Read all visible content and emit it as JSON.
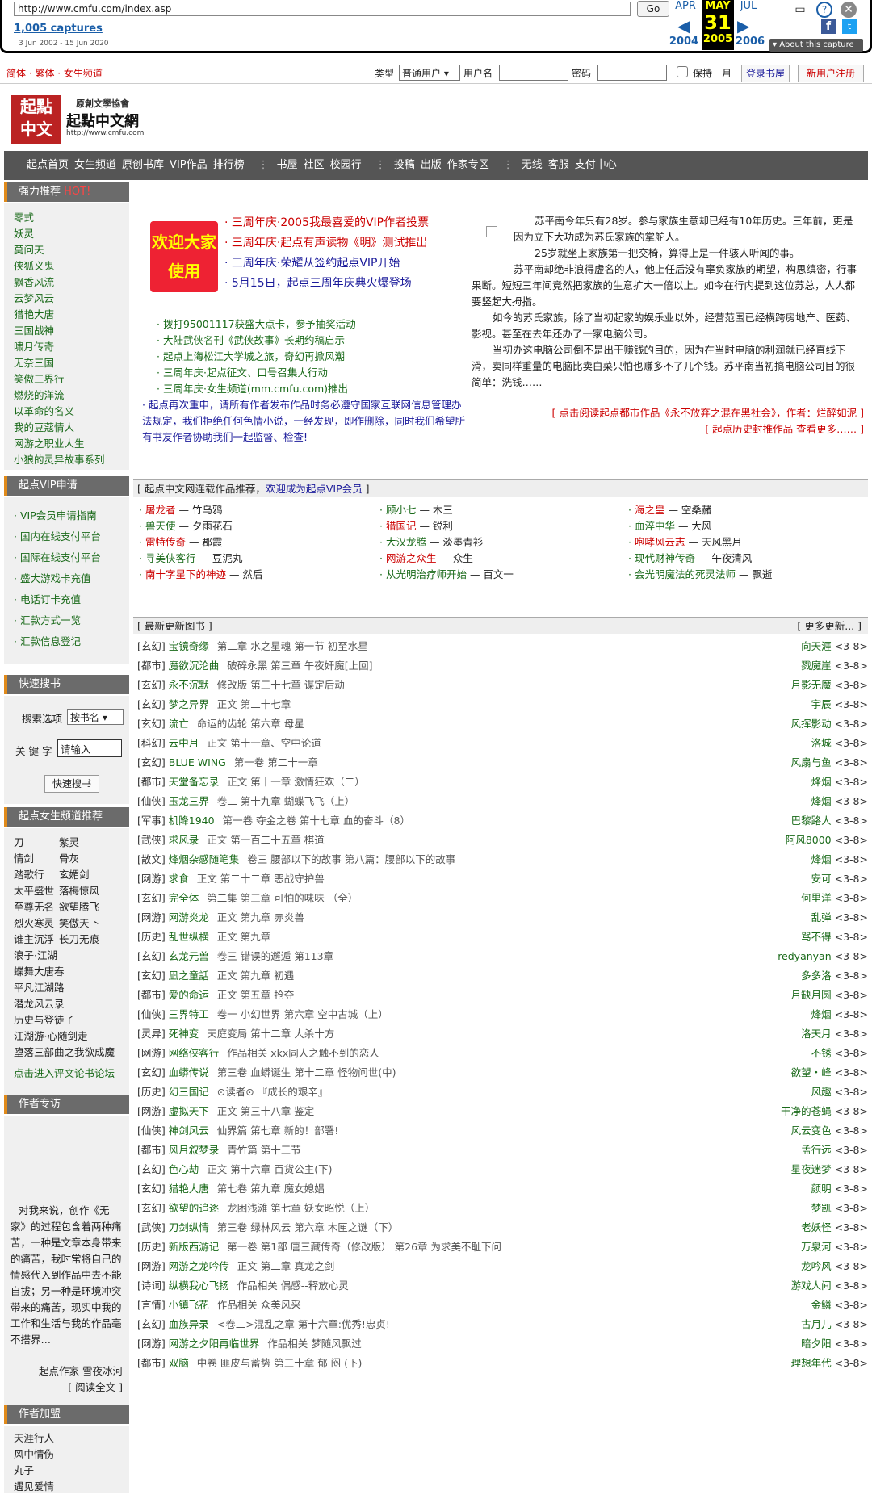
{
  "wayback": {
    "url": "http://www.cmfu.com/index.asp",
    "go": "Go",
    "captures": "1,005 captures",
    "range": "3 Jun 2002 - 15 Jun 2020",
    "months": [
      "APR",
      "MAY",
      "JUL"
    ],
    "day": "31",
    "years": [
      "2004",
      "2005",
      "2006"
    ],
    "about": "▾ About this capture"
  },
  "topbar": {
    "langs": "简体 · 繁体 · 女生频道",
    "type_label": "类型",
    "type_value": "普通用户",
    "user_label": "用户名",
    "pass_label": "密码",
    "keep_label": "保持一月",
    "login_btn": "登录书屋",
    "register_btn": "新用户注册"
  },
  "logo": {
    "line1": "原創文學協會",
    "line2": "起點中文網",
    "url": "http://www.cmfu.com"
  },
  "nav": [
    [
      "起点首页",
      "女生频道",
      "原创书库",
      "VIP作品",
      "排行榜"
    ],
    [
      "书屋",
      "社区",
      "校园行"
    ],
    [
      "投稿",
      "出版",
      "作家专区"
    ],
    [
      "无线",
      "客服",
      "支付中心"
    ]
  ],
  "strong": {
    "title": "强力推荐",
    "hot": "HOT!",
    "items": [
      "零式",
      "妖灵",
      "莫问天",
      "侠狐义鬼",
      "飘香风流",
      "云梦风云",
      "猎艳大唐",
      "三国战神",
      "啸月传奇",
      "无奈三国",
      "笑傲三界行",
      "燃烧的洋流",
      "以革命的名义",
      "我的豆蔻情人",
      "网游之职业人生",
      "小狼的灵异故事系列"
    ]
  },
  "promo": {
    "badge1": "欢迎大家",
    "badge2": "使用",
    "items": [
      "· 三周年庆·2005我最喜爱的VIP作者投票",
      "· 三周年庆·起点有声读物《明》测试推出",
      "· 三周年庆·荣耀从签约起点VIP开始",
      "· 5月15日，起点三周年庆典火爆登场"
    ],
    "news": [
      "· 拨打95001117获盛大点卡，参予抽奖活动",
      "· 大陆武侠名刊《武侠故事》长期约稿启示",
      "· 起点上海松江大学城之旅，奇幻再掀风潮",
      "· 三周年庆·起点征文、口号召集大行动",
      "· 三周年庆·女生频道(mm.cmfu.com)推出"
    ],
    "notice": "· 起点再次重申，请所有作者发布作品时务必遵守国家互联网信息管理办法规定，我们拒绝任何色情小说，一经发现，即作删除，同时我们希望所有书友作者协助我们一起监督、检查!"
  },
  "story": {
    "paras": [
      "苏平南今年只有28岁。参与家族生意却已经有10年历史。三年前，更是因为立下大功成为苏氏家族的掌舵人。",
      "25岁就坐上家族第一把交椅，算得上是一件骇人听闻的事。",
      "苏平南却绝非浪得虚名的人，他上任后没有辜负家族的期望，构思缜密，行事果断。短短三年间竟然把家族的生意扩大一倍以上。如今在行内提到这位苏总，人人都要竖起大拇指。",
      "如今的苏氏家族，除了当初起家的娱乐业以外，经营范围已经横跨房地产、医药、影视。甚至在去年还办了一家电脑公司。",
      "当初办这电脑公司倒不是出于赚钱的目的，因为在当时电脑的利润就已经直线下滑，卖同样重量的电脑比卖白菜只怕也赚多不了几个钱。苏平南当初搞电脑公司目的很简单：洗钱……"
    ],
    "link1": "[ 点击阅读起点都市作品《永不放弃之混在黑社会》，作者：烂醉如泥 ]",
    "link2": "[ 起点历史封推作品 查看更多…… ]"
  },
  "vipapply": {
    "title": "起点VIP申请",
    "items": [
      "· VIP会员申请指南",
      "· 国内在线支付平台",
      "· 国际在线支付平台",
      "· 盛大游戏卡充值",
      "· 电话订卡充值",
      "· 汇款方式一览",
      "· 汇款信息登记"
    ]
  },
  "vipworks": {
    "head": "[ 起点中文网连载作品推荐，",
    "head_link": "欢迎成为起点VIP会员",
    "head_end": " ]",
    "cols": [
      [
        [
          "屠龙者",
          "竹乌鸦"
        ],
        [
          "兽天使",
          "夕雨花石"
        ],
        [
          "雷特传奇",
          "郡霞"
        ],
        [
          "寻美侠客行",
          "豆泥丸"
        ],
        [
          "南十字星下的神迹",
          "然后"
        ]
      ],
      [
        [
          "顾小七",
          "木三"
        ],
        [
          "猎国记",
          "锐利"
        ],
        [
          "大汉龙腾",
          "淡墨青衫"
        ],
        [
          "网游之众生",
          "众生"
        ],
        [
          "从光明治疗师开始",
          "百文一"
        ]
      ],
      [
        [
          "海之皇",
          "空桑赭"
        ],
        [
          "血淬中华",
          "大风"
        ],
        [
          "咆哮风云志",
          "天风黑月"
        ],
        [
          "现代财神传奇",
          "午夜清风"
        ],
        [
          "会光明魔法的死灵法师",
          "飘逝"
        ]
      ]
    ]
  },
  "search": {
    "title": "快速搜书",
    "opt_label": "搜索选项",
    "opt_value": "按书名",
    "kw_label": "关 键 字",
    "kw_placeholder": "请输入",
    "btn": "快速搜书"
  },
  "girl": {
    "title": "起点女生频道推荐",
    "pairs": [
      [
        "刀",
        "紫灵"
      ],
      [
        "情剑",
        "骨灰"
      ],
      [
        "踏歌行",
        "玄媚剑"
      ],
      [
        "太平盛世",
        "落梅惊风"
      ],
      [
        "至尊无名",
        "欲望腾飞"
      ],
      [
        "烈火寒灵",
        "笑傲天下"
      ],
      [
        "谁主沉浮",
        "长刀无痕"
      ]
    ],
    "singles": [
      "浪子·江湖",
      "蝶舞大唐春",
      "平凡江湖路",
      "潜龙风云录",
      "历史与登徒子",
      "江湖游·心随剑走",
      "堕落三部曲之我欲成魔"
    ],
    "more": "点击进入评文论书论坛"
  },
  "talk": {
    "title": "作者专访",
    "text": "对我来说，创作《无家》的过程包含着两种痛苦，一种是文章本身带来的痛苦，我时常将自己的情感代入到作品中去不能自拔；另一种是环境冲突带来的痛苦，现实中我的工作和生活与我的作品毫不搭界…",
    "sign": "起点作家 雪夜冰河",
    "more": "[ 阅读全文 ]"
  },
  "join": {
    "title": "作者加盟",
    "items": [
      "天涯行人",
      "风中情伤",
      "丸子",
      "遇见爱情"
    ]
  },
  "updates": {
    "head": "[ 最新更新图书 ]",
    "more": "[ 更多更新... ]",
    "date": "<3-8>",
    "rows": [
      [
        "[玄幻]",
        "宝镜奇缘",
        "第二章 水之星魂 第一节 初至水星",
        "向天涯"
      ],
      [
        "[都市]",
        "魔欲沉沦曲",
        "破碎永黑 第三章 午夜奸魔[上回]",
        "戮魔崖"
      ],
      [
        "[玄幻]",
        "永不沉默",
        "修改版 第三十七章 谋定后动",
        "月影无魔"
      ],
      [
        "[玄幻]",
        "梦之异界",
        "正文 第二十七章",
        "宇辰"
      ],
      [
        "[玄幻]",
        "流亡",
        "命运的齿轮 第六章 母星",
        "风挥影动"
      ],
      [
        "[科幻]",
        "云中月",
        "正文 第十一章、空中论道",
        "洛城"
      ],
      [
        "[玄幻]",
        "BLUE WING",
        "第一卷 第二十一章",
        "风扇与鱼"
      ],
      [
        "[都市]",
        "天堂备忘录",
        "正文 第十一章 激情狂欢（二）",
        "烽烟"
      ],
      [
        "[仙侠]",
        "玉龙三界",
        "卷二 第十九章 蝴蝶飞飞（上）",
        "烽烟"
      ],
      [
        "[军事]",
        "机降1940",
        "第一卷 夺金之卷 第十七章 血的奋斗（8）",
        "巴黎路人"
      ],
      [
        "[武侠]",
        "求风录",
        "正文 第一百二十五章 棋道",
        "阿风8000"
      ],
      [
        "[散文]",
        "烽烟杂感随笔集",
        "卷三 腰部以下的故事 第八篇：腰部以下的故事",
        "烽烟"
      ],
      [
        "[网游]",
        "求食",
        "正文 第二十二章 恶战守护兽",
        "安可"
      ],
      [
        "[玄幻]",
        "完全体",
        "第二集 第三章 可怕的味味 （全）",
        "何里洋"
      ],
      [
        "[网游]",
        "网游炎龙",
        "正文 第九章 赤炎兽",
        "乱弹"
      ],
      [
        "[历史]",
        "乱世纵横",
        "正文 第九章",
        "骂不得"
      ],
      [
        "[玄幻]",
        "玄龙元兽",
        "卷三 错误的邂逅 第113章",
        "redyanyan"
      ],
      [
        "[玄幻]",
        "凪之童話",
        "正文 第九章 初遇",
        "多多洛"
      ],
      [
        "[都市]",
        "爱的命运",
        "正文 第五章 抢夺",
        "月缺月圆"
      ],
      [
        "[仙侠]",
        "三界特工",
        "卷一 小幻世界 第六章 空中古城（上）",
        "烽烟"
      ],
      [
        "[灵异]",
        "死神变",
        "天庭变局 第十二章 大杀十方",
        "洛天月"
      ],
      [
        "[网游]",
        "网络侠客行",
        "作品相关 xkx同人之触不到的恋人",
        "不锈"
      ],
      [
        "[玄幻]",
        "血蟒传说",
        "第三卷 血蟒诞生 第十二章 怪物问世(中)",
        "欲望・峰"
      ],
      [
        "[历史]",
        "幻三国记",
        "⊙读者⊙ 『成长的艰辛』",
        "风趣"
      ],
      [
        "[网游]",
        "虚拟天下",
        "正文 第三十八章 鉴定",
        "干净的苍蝇"
      ],
      [
        "[仙侠]",
        "神剑风云",
        "仙界篇 第七章 新的！部署!",
        "风云变色"
      ],
      [
        "[都市]",
        "风月叙梦录",
        "青竹篇 第十三节",
        "孟行远"
      ],
      [
        "[玄幻]",
        "色心劫",
        "正文 第十六章 百货公主(下)",
        "星夜迷梦"
      ],
      [
        "[玄幻]",
        "猎艳大唐",
        "第七卷 第九章 魔女媳娼",
        "颜明"
      ],
      [
        "[玄幻]",
        "欲望的追逐",
        "龙困浅滩 第七章 妖女昭悦（上）",
        "梦凯"
      ],
      [
        "[武侠]",
        "刀剑纵情",
        "第三卷 绿林风云 第六章 木匣之谜（下）",
        "老妖怪"
      ],
      [
        "[历史]",
        "新版西游记",
        "第一卷 第1部 唐三藏传奇（修改版） 第26章 为求美不耻下问",
        "万泉河"
      ],
      [
        "[网游]",
        "网游之龙吟传",
        "正文 第二章 真龙之剑",
        "龙吟风"
      ],
      [
        "[诗词]",
        "纵横我心飞扬",
        "作品相关 偶感--释放心灵",
        "游戏人间"
      ],
      [
        "[言情]",
        "小镇飞花",
        "作品相关 众美风采",
        "金鳞"
      ],
      [
        "[玄幻]",
        "血族异录",
        "<卷二>混乱之章 第十六章:优秀!忠贞!",
        "古月儿"
      ],
      [
        "[网游]",
        "网游之夕阳再临世界",
        "作品相关 梦随风飘过",
        "暗夕阳"
      ],
      [
        "[都市]",
        "双脑",
        "中卷 匪皮与蓄势 第三十章 郁 闷 (下)",
        "理想年代"
      ]
    ]
  }
}
